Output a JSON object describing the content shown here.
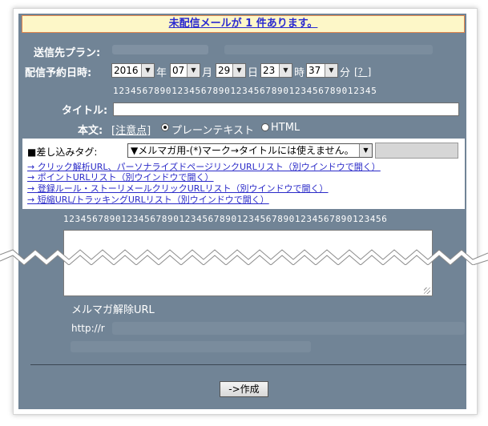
{
  "notice": {
    "text": "未配信メールが 1 件あります。"
  },
  "form": {
    "plan_label": "送信先プラン:",
    "schedule_label": "配信予約日時:",
    "schedule": {
      "year": "2016",
      "year_unit": "年",
      "month": "07",
      "month_unit": "月",
      "day": "29",
      "day_unit": "日",
      "hour": "23",
      "hour_unit": "時",
      "minute": "37",
      "minute_unit": "分",
      "help": "[？]"
    },
    "ruler_top": "123456789012345678901234567890123456789012345",
    "title_label": "タイトル:",
    "title_value": "",
    "body_label": "本文:",
    "body_notice_open": "[",
    "body_notice_link": "注意点",
    "body_notice_close": "]",
    "format_plain": "プレーンテキスト",
    "format_html": "HTML",
    "insert": {
      "label": "■差し込みタグ:",
      "selected": "▼メルマガ用-(*)マーク→タイトルには使えません。",
      "links": [
        "→ クリック解析URL、パーソナライズドページリンクURLリスト（別ウインドウで開く）",
        "→ ポイントURLリスト（別ウインドウで開く）",
        "→ 登録ルール・ストーリメールクリックURLリスト（別ウインドウで開く）",
        "→ 短縮URL/トラッキングURLリスト（別ウインドウで開く）"
      ]
    },
    "ruler_body": "12345678901234567890123456789012345678901234567890123456",
    "unsubscribe_label": "メルマガ解除URL",
    "unsubscribe_url": "http://r",
    "submit": "->作成"
  }
}
